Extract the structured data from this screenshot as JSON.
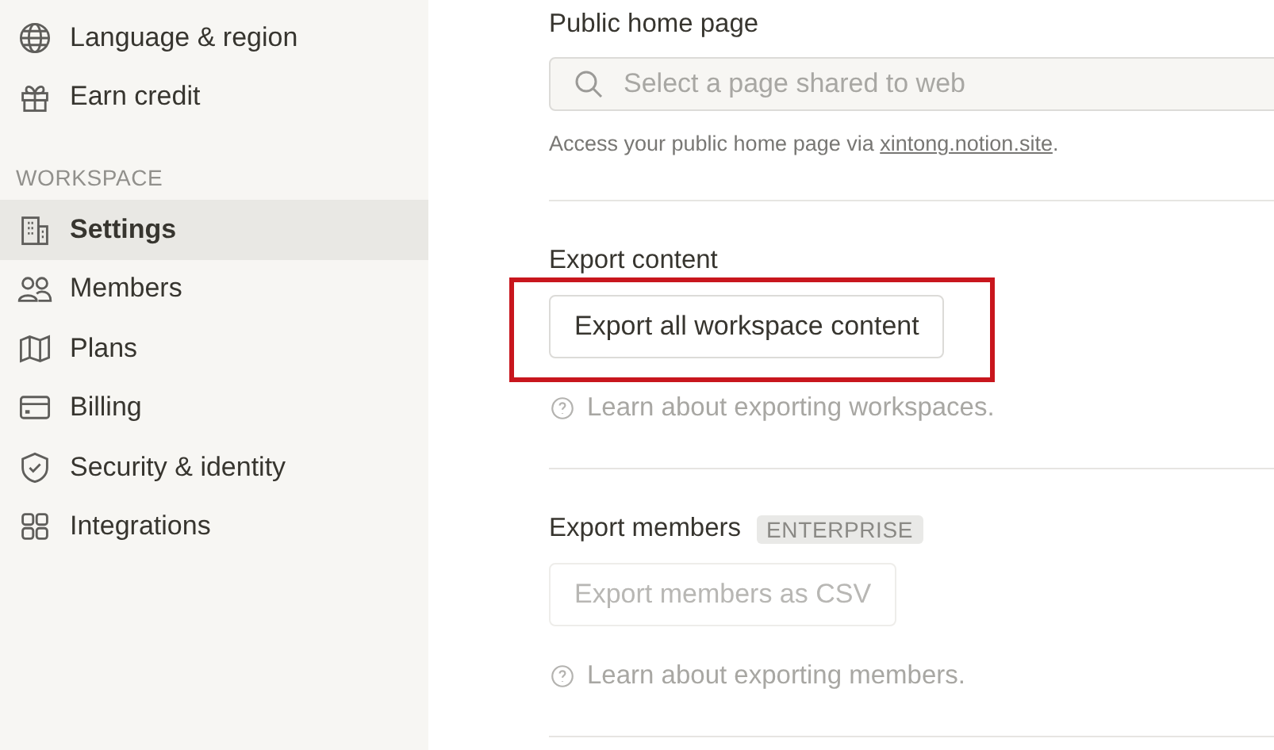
{
  "sidebar": {
    "items": [
      {
        "label": "Language & region",
        "selected": false
      },
      {
        "label": "Earn credit",
        "selected": false
      }
    ],
    "workspace": {
      "header": "WORKSPACE",
      "items": [
        {
          "label": "Settings",
          "selected": true
        },
        {
          "label": "Members",
          "selected": false
        },
        {
          "label": "Plans",
          "selected": false
        },
        {
          "label": "Billing",
          "selected": false
        },
        {
          "label": "Security & identity",
          "selected": false
        },
        {
          "label": "Integrations",
          "selected": false
        }
      ]
    }
  },
  "public_home": {
    "title": "Public home page",
    "field": {
      "placeholder": "Select a page shared to web"
    },
    "caption": {
      "text": "Access your public home page via ",
      "link": "xintong.notion.site",
      "end": "."
    }
  },
  "export_sections": [
    {
      "title": "Export content",
      "button": {
        "label": "Export all workspace content",
        "disabled": false
      },
      "highlighted": true,
      "help": "Learn about exporting workspaces."
    },
    {
      "title": "Export members",
      "badge": "ENTERPRISE",
      "button": {
        "label": "Export members as CSV",
        "disabled": true
      },
      "highlighted": false,
      "help": "Learn about exporting members."
    }
  ]
}
